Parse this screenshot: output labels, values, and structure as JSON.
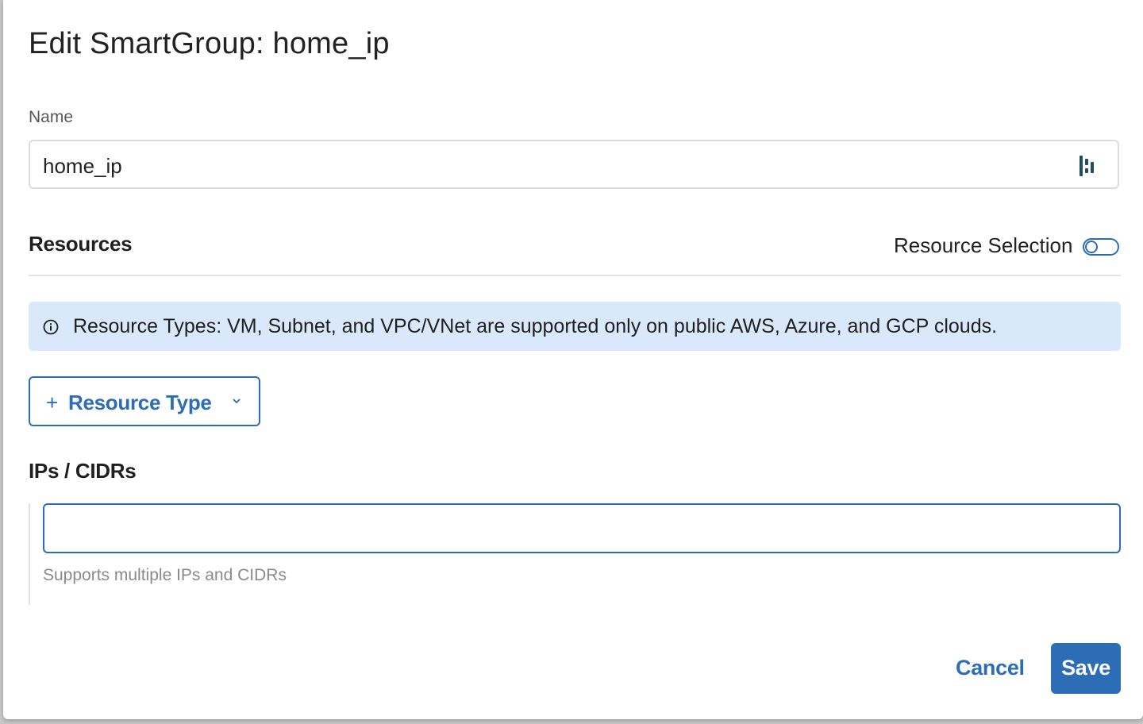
{
  "dialog": {
    "title": "Edit SmartGroup: home_ip"
  },
  "name_field": {
    "label": "Name",
    "value": "home_ip",
    "icon": "password-manager-icon"
  },
  "resources": {
    "header": "Resources",
    "toggle_label": "Resource Selection",
    "toggle_on": false,
    "info_icon": "info-circle-icon",
    "info_text": "Resource Types: VM, Subnet, and VPC/VNet are supported only on public AWS, Azure, and GCP clouds.",
    "add_button_label": "Resource Type",
    "add_button_icon": "plus-icon",
    "add_button_dropdown_icon": "chevron-down-icon"
  },
  "ips": {
    "header": "IPs / CIDRs",
    "value": "",
    "help_text": "Supports multiple IPs and CIDRs"
  },
  "footer": {
    "cancel_label": "Cancel",
    "save_label": "Save"
  },
  "colors": {
    "accent": "#2d6db5",
    "info_bg": "#d9e9fb",
    "text": "#222222",
    "muted": "#8a8a8a"
  }
}
